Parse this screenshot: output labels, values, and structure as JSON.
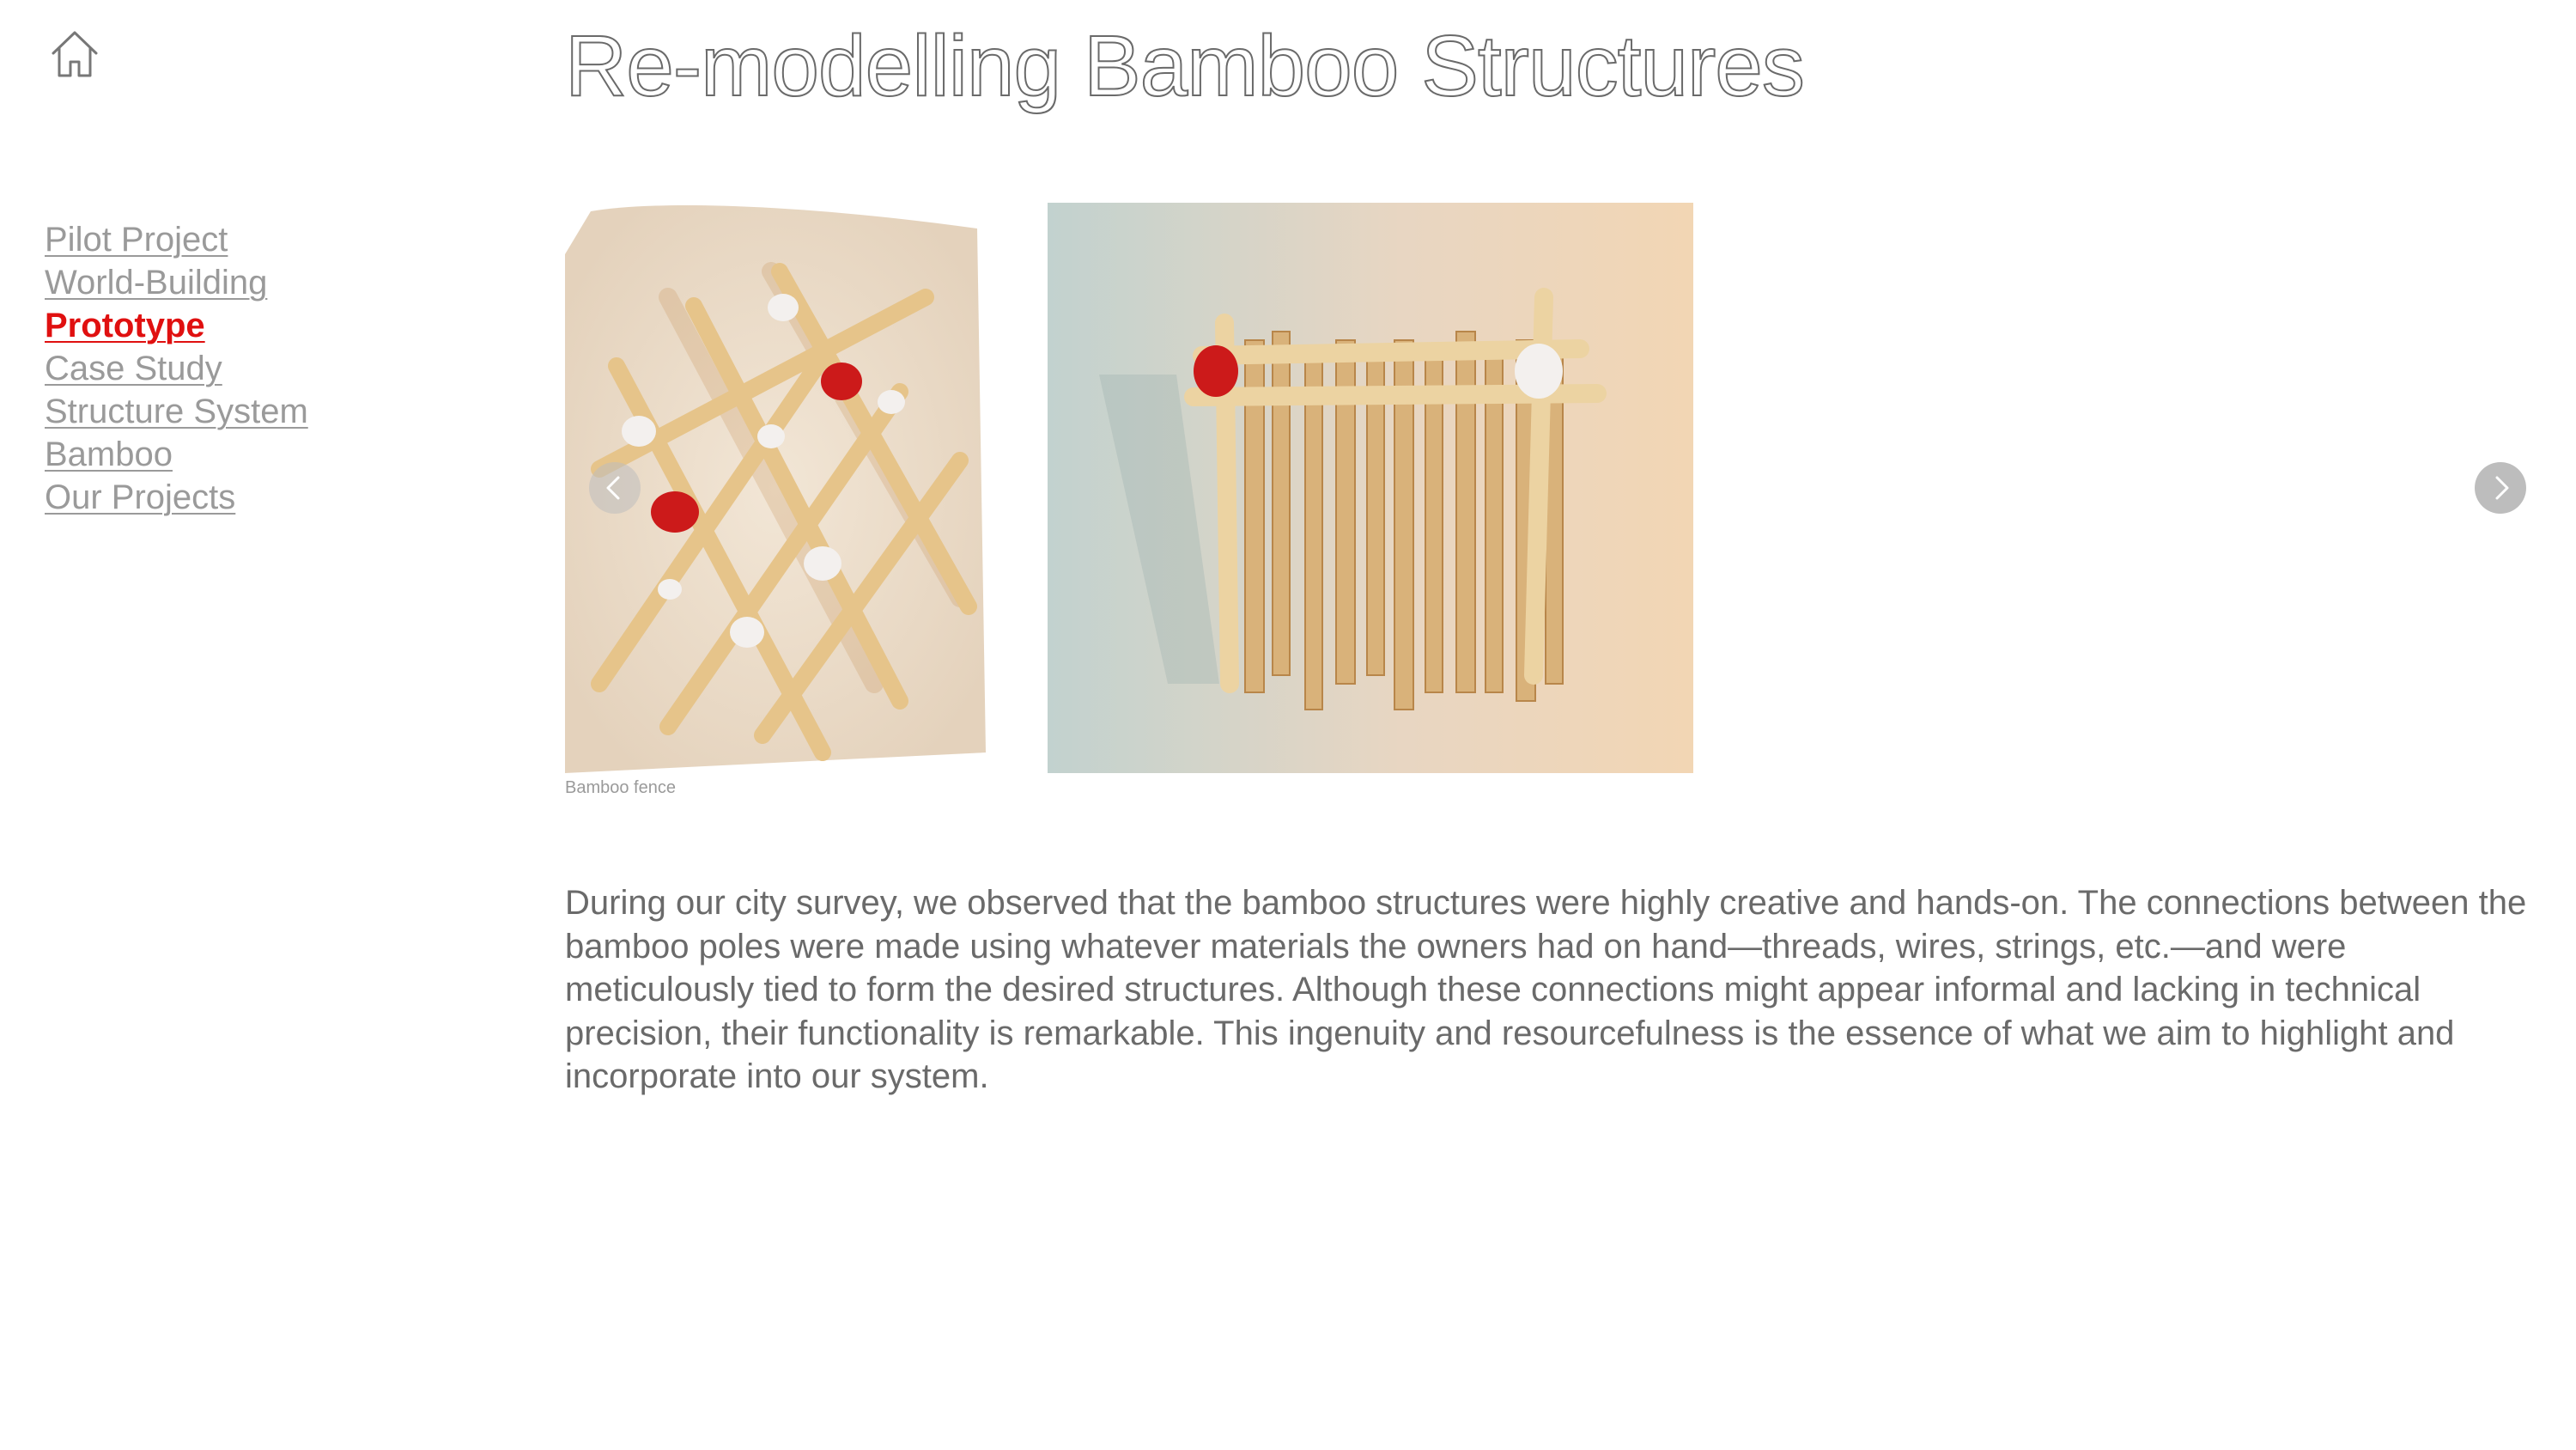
{
  "header": {
    "home_icon": "home-icon",
    "title": "Re-modelling Bamboo Structures"
  },
  "nav": {
    "items": [
      {
        "label": "Pilot Project",
        "active": false
      },
      {
        "label": "World-Building",
        "active": false
      },
      {
        "label": "Prototype",
        "active": true
      },
      {
        "label": "Case Study",
        "active": false
      },
      {
        "label": "Structure System",
        "active": false
      },
      {
        "label": "Bamboo",
        "active": false
      },
      {
        "label": "Our Projects",
        "active": false
      }
    ]
  },
  "gallery": {
    "caption": "Bamboo fence",
    "prev_icon": "chevron-left-icon",
    "next_icon": "chevron-right-icon",
    "slides": [
      "bamboo-grid-model-photo",
      "bamboo-fence-model-photo"
    ]
  },
  "content": {
    "paragraph": "During our city survey, we observed that the bamboo structures were highly creative and hands-on. The connections between the bamboo poles were made using whatever materials the owners had on hand—threads, wires, strings, etc.—and were meticulously tied to form the desired structures. Although these connections might appear informal and lacking in technical precision, their functionality is remarkable. This ingenuity and resourcefulness is the essence of what we aim to highlight and incorporate into our system."
  },
  "colors": {
    "active_nav": "#e01010",
    "nav": "#9a9a9a",
    "text": "#6a6a6a",
    "background": "#ffffff"
  }
}
